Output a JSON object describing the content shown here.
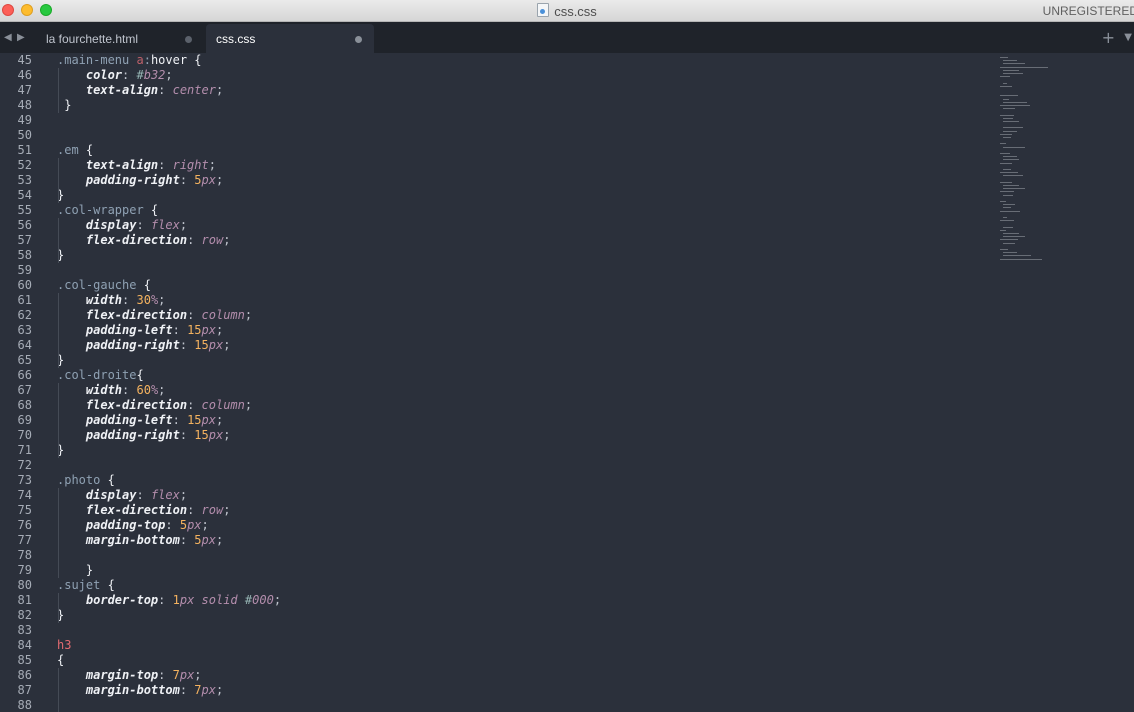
{
  "window": {
    "title": "css.css",
    "registration": "UNREGISTERED"
  },
  "tabs": [
    {
      "label": "la fourchette.html",
      "active": false
    },
    {
      "label": "css.css",
      "active": true
    }
  ],
  "icons": {
    "close": "close-traffic-light",
    "minimize": "minimize-traffic-light",
    "maximize": "maximize-traffic-light",
    "file": "css-file-icon",
    "nav_back": "triangle-left-icon",
    "nav_forward": "triangle-right-icon",
    "new_tab": "plus-icon",
    "tab_list": "triangle-down-icon"
  },
  "lines": [
    {
      "n": "45",
      "t": [
        [
          "sel",
          ".main-menu "
        ],
        [
          "selr",
          "a"
        ],
        [
          "sel",
          ":"
        ],
        [
          "hov",
          "hover"
        ],
        [
          "br",
          " {"
        ]
      ]
    },
    {
      "n": "46",
      "t": [
        [
          "pl",
          "    "
        ],
        [
          "prop",
          "color"
        ],
        [
          "pl",
          ": "
        ],
        [
          "hash",
          "#"
        ],
        [
          "kw",
          "b32"
        ],
        [
          "pl",
          ";"
        ]
      ]
    },
    {
      "n": "47",
      "t": [
        [
          "pl",
          "    "
        ],
        [
          "prop",
          "text-align"
        ],
        [
          "pl",
          ": "
        ],
        [
          "kw",
          "center"
        ],
        [
          "pl",
          ";"
        ]
      ]
    },
    {
      "n": "48",
      "t": [
        [
          "br",
          " }"
        ]
      ]
    },
    {
      "n": "49",
      "t": []
    },
    {
      "n": "50",
      "t": []
    },
    {
      "n": "51",
      "t": [
        [
          "sel",
          ".em"
        ],
        [
          "br",
          " {"
        ]
      ]
    },
    {
      "n": "52",
      "t": [
        [
          "pl",
          "    "
        ],
        [
          "prop",
          "text-align"
        ],
        [
          "pl",
          ": "
        ],
        [
          "kw",
          "right"
        ],
        [
          "pl",
          ";"
        ]
      ]
    },
    {
      "n": "53",
      "t": [
        [
          "pl",
          "    "
        ],
        [
          "prop",
          "padding-right"
        ],
        [
          "pl",
          ": "
        ],
        [
          "num",
          "5"
        ],
        [
          "unit",
          "px"
        ],
        [
          "pl",
          ";"
        ]
      ]
    },
    {
      "n": "54",
      "t": [
        [
          "br",
          "}"
        ]
      ]
    },
    {
      "n": "55",
      "t": [
        [
          "sel",
          ".col-wrapper"
        ],
        [
          "br",
          " {"
        ]
      ]
    },
    {
      "n": "56",
      "t": [
        [
          "pl",
          "    "
        ],
        [
          "prop",
          "display"
        ],
        [
          "pl",
          ": "
        ],
        [
          "kw",
          "flex"
        ],
        [
          "pl",
          ";"
        ]
      ]
    },
    {
      "n": "57",
      "t": [
        [
          "pl",
          "    "
        ],
        [
          "prop",
          "flex-direction"
        ],
        [
          "pl",
          ": "
        ],
        [
          "kw",
          "row"
        ],
        [
          "pl",
          ";"
        ]
      ]
    },
    {
      "n": "58",
      "t": [
        [
          "br",
          "}"
        ]
      ]
    },
    {
      "n": "59",
      "t": []
    },
    {
      "n": "60",
      "t": [
        [
          "sel",
          ".col-gauche"
        ],
        [
          "br",
          " {"
        ]
      ]
    },
    {
      "n": "61",
      "t": [
        [
          "pl",
          "    "
        ],
        [
          "prop",
          "width"
        ],
        [
          "pl",
          ": "
        ],
        [
          "num",
          "30"
        ],
        [
          "unit",
          "%"
        ],
        [
          "pl",
          ";"
        ]
      ]
    },
    {
      "n": "62",
      "t": [
        [
          "pl",
          "    "
        ],
        [
          "prop",
          "flex-direction"
        ],
        [
          "pl",
          ": "
        ],
        [
          "kw",
          "column"
        ],
        [
          "pl",
          ";"
        ]
      ]
    },
    {
      "n": "63",
      "t": [
        [
          "pl",
          "    "
        ],
        [
          "prop",
          "padding-left"
        ],
        [
          "pl",
          ": "
        ],
        [
          "num",
          "15"
        ],
        [
          "unit",
          "px"
        ],
        [
          "pl",
          ";"
        ]
      ]
    },
    {
      "n": "64",
      "t": [
        [
          "pl",
          "    "
        ],
        [
          "prop",
          "padding-right"
        ],
        [
          "pl",
          ": "
        ],
        [
          "num",
          "15"
        ],
        [
          "unit",
          "px"
        ],
        [
          "pl",
          ";"
        ]
      ]
    },
    {
      "n": "65",
      "t": [
        [
          "br",
          "}"
        ]
      ]
    },
    {
      "n": "66",
      "t": [
        [
          "sel",
          ".col-droite"
        ],
        [
          "br",
          "{"
        ]
      ]
    },
    {
      "n": "67",
      "t": [
        [
          "pl",
          "    "
        ],
        [
          "prop",
          "width"
        ],
        [
          "pl",
          ": "
        ],
        [
          "num",
          "60"
        ],
        [
          "unit",
          "%"
        ],
        [
          "pl",
          ";"
        ]
      ]
    },
    {
      "n": "68",
      "t": [
        [
          "pl",
          "    "
        ],
        [
          "prop",
          "flex-direction"
        ],
        [
          "pl",
          ": "
        ],
        [
          "kw",
          "column"
        ],
        [
          "pl",
          ";"
        ]
      ]
    },
    {
      "n": "69",
      "t": [
        [
          "pl",
          "    "
        ],
        [
          "prop",
          "padding-left"
        ],
        [
          "pl",
          ": "
        ],
        [
          "num",
          "15"
        ],
        [
          "unit",
          "px"
        ],
        [
          "pl",
          ";"
        ]
      ]
    },
    {
      "n": "70",
      "t": [
        [
          "pl",
          "    "
        ],
        [
          "prop",
          "padding-right"
        ],
        [
          "pl",
          ": "
        ],
        [
          "num",
          "15"
        ],
        [
          "unit",
          "px"
        ],
        [
          "pl",
          ";"
        ]
      ]
    },
    {
      "n": "71",
      "t": [
        [
          "br",
          "}"
        ]
      ]
    },
    {
      "n": "72",
      "t": []
    },
    {
      "n": "73",
      "t": [
        [
          "sel",
          ".photo"
        ],
        [
          "br",
          " {"
        ]
      ]
    },
    {
      "n": "74",
      "t": [
        [
          "pl",
          "    "
        ],
        [
          "prop",
          "display"
        ],
        [
          "pl",
          ": "
        ],
        [
          "kw",
          "flex"
        ],
        [
          "pl",
          ";"
        ]
      ]
    },
    {
      "n": "75",
      "t": [
        [
          "pl",
          "    "
        ],
        [
          "prop",
          "flex-direction"
        ],
        [
          "pl",
          ": "
        ],
        [
          "kw",
          "row"
        ],
        [
          "pl",
          ";"
        ]
      ]
    },
    {
      "n": "76",
      "t": [
        [
          "pl",
          "    "
        ],
        [
          "prop",
          "padding-top"
        ],
        [
          "pl",
          ": "
        ],
        [
          "num",
          "5"
        ],
        [
          "unit",
          "px"
        ],
        [
          "pl",
          ";"
        ]
      ]
    },
    {
      "n": "77",
      "t": [
        [
          "pl",
          "    "
        ],
        [
          "prop",
          "margin-bottom"
        ],
        [
          "pl",
          ": "
        ],
        [
          "num",
          "5"
        ],
        [
          "unit",
          "px"
        ],
        [
          "pl",
          ";"
        ]
      ]
    },
    {
      "n": "78",
      "t": []
    },
    {
      "n": "79",
      "t": [
        [
          "br",
          "    }"
        ]
      ]
    },
    {
      "n": "80",
      "t": [
        [
          "sel",
          ".sujet"
        ],
        [
          "br",
          " {"
        ]
      ]
    },
    {
      "n": "81",
      "t": [
        [
          "pl",
          "    "
        ],
        [
          "prop",
          "border-top"
        ],
        [
          "pl",
          ": "
        ],
        [
          "num",
          "1"
        ],
        [
          "unit",
          "px"
        ],
        [
          "pl",
          " "
        ],
        [
          "kw",
          "solid"
        ],
        [
          "pl",
          " "
        ],
        [
          "hash",
          "#"
        ],
        [
          "kw",
          "000"
        ],
        [
          "pl",
          ";"
        ]
      ]
    },
    {
      "n": "82",
      "t": [
        [
          "br",
          "}"
        ]
      ]
    },
    {
      "n": "83",
      "t": []
    },
    {
      "n": "84",
      "t": [
        [
          "tag",
          "h3"
        ]
      ]
    },
    {
      "n": "85",
      "t": [
        [
          "br",
          "{"
        ]
      ]
    },
    {
      "n": "86",
      "t": [
        [
          "pl",
          "    "
        ],
        [
          "prop",
          "margin-top"
        ],
        [
          "pl",
          ": "
        ],
        [
          "num",
          "7"
        ],
        [
          "unit",
          "px"
        ],
        [
          "pl",
          ";"
        ]
      ]
    },
    {
      "n": "87",
      "t": [
        [
          "pl",
          "    "
        ],
        [
          "prop",
          "margin-bottom"
        ],
        [
          "pl",
          ": "
        ],
        [
          "num",
          "7"
        ],
        [
          "unit",
          "px"
        ],
        [
          "pl",
          ";"
        ]
      ]
    },
    {
      "n": "88",
      "t": []
    }
  ]
}
